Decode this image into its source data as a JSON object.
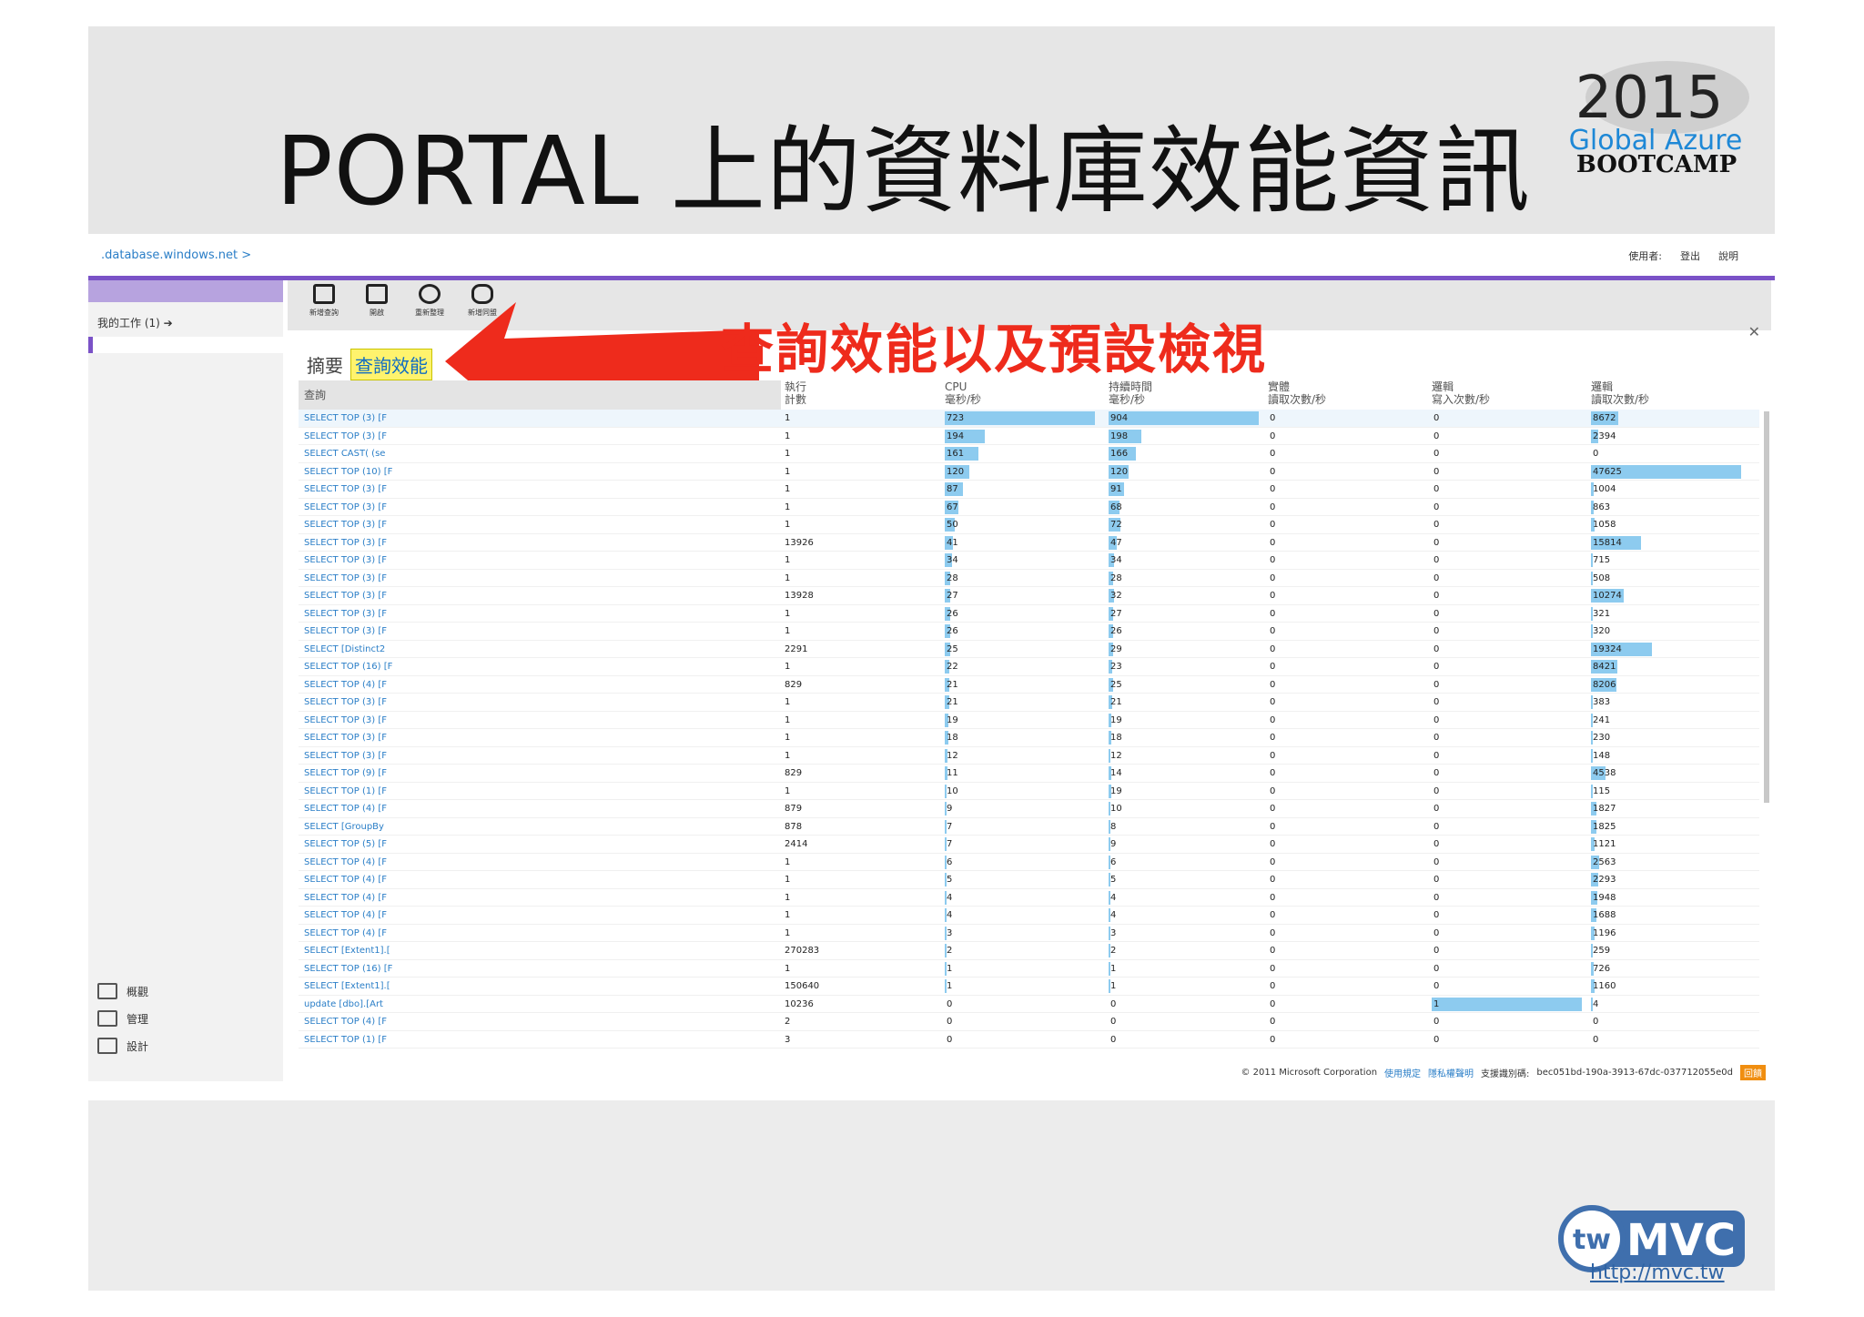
{
  "slide": {
    "title": "PORTAL 上的資料庫效能資訊",
    "annotation": "查詢效能以及預設檢視",
    "logo_year": "2015",
    "logo_line1": "Global Azure",
    "logo_line2": "BOOTCAMP",
    "mvc_logo": "MVC",
    "mvc_url": "http://mvc.tw"
  },
  "portal": {
    "breadcrumb": ".database.windows.net >",
    "user_label": "使用者:",
    "logout": "登出",
    "help": "說明",
    "my_work": "我的工作 (1)",
    "nav": [
      {
        "label": "概觀",
        "icon": "overview-icon"
      },
      {
        "label": "管理",
        "icon": "manage-icon"
      },
      {
        "label": "設計",
        "icon": "design-icon"
      }
    ],
    "toolbar": [
      {
        "label": "新增查詢",
        "icon": "new-query-icon"
      },
      {
        "label": "開啟",
        "icon": "open-folder-icon"
      },
      {
        "label": "重新整理",
        "icon": "refresh-icon"
      },
      {
        "label": "新增同盟",
        "icon": "add-federation-icon"
      }
    ],
    "tabs": {
      "summary": "摘要",
      "query_perf": "查詢效能"
    },
    "columns": {
      "query": "查詢",
      "exec_1": "執行",
      "exec_2": "計數",
      "cpu_1": "CPU",
      "cpu_2": "毫秒/秒",
      "dur_1": "持續時間",
      "dur_2": "毫秒/秒",
      "phys_1": "實體",
      "phys_2": "讀取次數/秒",
      "lw_1": "邏輯",
      "lw_2": "寫入次數/秒",
      "lr_1": "邏輯",
      "lr_2": "讀取次數/秒"
    },
    "rows": [
      {
        "q": "SELECT TOP (3) [F",
        "e": "1",
        "cpu": "723",
        "dur": "904",
        "phys": "0",
        "lw": "0",
        "lr": "8672"
      },
      {
        "q": "SELECT TOP (3) [F",
        "e": "1",
        "cpu": "194",
        "dur": "198",
        "phys": "0",
        "lw": "0",
        "lr": "2394"
      },
      {
        "q": "SELECT CAST( (se",
        "e": "1",
        "cpu": "161",
        "dur": "166",
        "phys": "0",
        "lw": "0",
        "lr": "0"
      },
      {
        "q": "SELECT TOP (10) [F",
        "e": "1",
        "cpu": "120",
        "dur": "120",
        "phys": "0",
        "lw": "0",
        "lr": "47625"
      },
      {
        "q": "SELECT TOP (3) [F",
        "e": "1",
        "cpu": "87",
        "dur": "91",
        "phys": "0",
        "lw": "0",
        "lr": "1004"
      },
      {
        "q": "SELECT TOP (3) [F",
        "e": "1",
        "cpu": "67",
        "dur": "68",
        "phys": "0",
        "lw": "0",
        "lr": "863"
      },
      {
        "q": "SELECT TOP (3) [F",
        "e": "1",
        "cpu": "50",
        "dur": "72",
        "phys": "0",
        "lw": "0",
        "lr": "1058"
      },
      {
        "q": "SELECT TOP (3) [F",
        "e": "13926",
        "cpu": "41",
        "dur": "47",
        "phys": "0",
        "lw": "0",
        "lr": "15814"
      },
      {
        "q": "SELECT TOP (3) [F",
        "e": "1",
        "cpu": "34",
        "dur": "34",
        "phys": "0",
        "lw": "0",
        "lr": "715"
      },
      {
        "q": "SELECT TOP (3) [F",
        "e": "1",
        "cpu": "28",
        "dur": "28",
        "phys": "0",
        "lw": "0",
        "lr": "508"
      },
      {
        "q": "SELECT TOP (3) [F",
        "e": "13928",
        "cpu": "27",
        "dur": "32",
        "phys": "0",
        "lw": "0",
        "lr": "10274"
      },
      {
        "q": "SELECT TOP (3) [F",
        "e": "1",
        "cpu": "26",
        "dur": "27",
        "phys": "0",
        "lw": "0",
        "lr": "321"
      },
      {
        "q": "SELECT TOP (3) [F",
        "e": "1",
        "cpu": "26",
        "dur": "26",
        "phys": "0",
        "lw": "0",
        "lr": "320"
      },
      {
        "q": "SELECT [Distinct2",
        "e": "2291",
        "cpu": "25",
        "dur": "29",
        "phys": "0",
        "lw": "0",
        "lr": "19324"
      },
      {
        "q": "SELECT TOP (16) [F",
        "e": "1",
        "cpu": "22",
        "dur": "23",
        "phys": "0",
        "lw": "0",
        "lr": "8421"
      },
      {
        "q": "SELECT TOP (4) [F",
        "e": "829",
        "cpu": "21",
        "dur": "25",
        "phys": "0",
        "lw": "0",
        "lr": "8206"
      },
      {
        "q": "SELECT TOP (3) [F",
        "e": "1",
        "cpu": "21",
        "dur": "21",
        "phys": "0",
        "lw": "0",
        "lr": "383"
      },
      {
        "q": "SELECT TOP (3) [F",
        "e": "1",
        "cpu": "19",
        "dur": "19",
        "phys": "0",
        "lw": "0",
        "lr": "241"
      },
      {
        "q": "SELECT TOP (3) [F",
        "e": "1",
        "cpu": "18",
        "dur": "18",
        "phys": "0",
        "lw": "0",
        "lr": "230"
      },
      {
        "q": "SELECT TOP (3) [F",
        "e": "1",
        "cpu": "12",
        "dur": "12",
        "phys": "0",
        "lw": "0",
        "lr": "148"
      },
      {
        "q": "SELECT TOP (9) [F",
        "e": "829",
        "cpu": "11",
        "dur": "14",
        "phys": "0",
        "lw": "0",
        "lr": "4538"
      },
      {
        "q": "SELECT TOP (1) [F",
        "e": "1",
        "cpu": "10",
        "dur": "19",
        "phys": "0",
        "lw": "0",
        "lr": "115"
      },
      {
        "q": "SELECT TOP (4) [F",
        "e": "879",
        "cpu": "9",
        "dur": "10",
        "phys": "0",
        "lw": "0",
        "lr": "1827"
      },
      {
        "q": "SELECT [GroupBy",
        "e": "878",
        "cpu": "7",
        "dur": "8",
        "phys": "0",
        "lw": "0",
        "lr": "1825"
      },
      {
        "q": "SELECT TOP (5) [F",
        "e": "2414",
        "cpu": "7",
        "dur": "9",
        "phys": "0",
        "lw": "0",
        "lr": "1121"
      },
      {
        "q": "SELECT TOP (4) [F",
        "e": "1",
        "cpu": "6",
        "dur": "6",
        "phys": "0",
        "lw": "0",
        "lr": "2563"
      },
      {
        "q": "SELECT TOP (4) [F",
        "e": "1",
        "cpu": "5",
        "dur": "5",
        "phys": "0",
        "lw": "0",
        "lr": "2293"
      },
      {
        "q": "SELECT TOP (4) [F",
        "e": "1",
        "cpu": "4",
        "dur": "4",
        "phys": "0",
        "lw": "0",
        "lr": "1948"
      },
      {
        "q": "SELECT TOP (4) [F",
        "e": "1",
        "cpu": "4",
        "dur": "4",
        "phys": "0",
        "lw": "0",
        "lr": "1688"
      },
      {
        "q": "SELECT TOP (4) [F",
        "e": "1",
        "cpu": "3",
        "dur": "3",
        "phys": "0",
        "lw": "0",
        "lr": "1196"
      },
      {
        "q": "SELECT [Extent1].[",
        "e": "270283",
        "cpu": "2",
        "dur": "2",
        "phys": "0",
        "lw": "0",
        "lr": "259"
      },
      {
        "q": "SELECT TOP (16) [F",
        "e": "1",
        "cpu": "1",
        "dur": "1",
        "phys": "0",
        "lw": "0",
        "lr": "726"
      },
      {
        "q": "SELECT [Extent1].[",
        "e": "150640",
        "cpu": "1",
        "dur": "1",
        "phys": "0",
        "lw": "0",
        "lr": "1160"
      },
      {
        "q": "update [dbo].[Art",
        "e": "10236",
        "cpu": "0",
        "dur": "0",
        "phys": "0",
        "lw": "1",
        "lr": "4"
      },
      {
        "q": "SELECT TOP (4) [F",
        "e": "2",
        "cpu": "0",
        "dur": "0",
        "phys": "0",
        "lw": "0",
        "lr": "0"
      },
      {
        "q": "SELECT TOP (1) [F",
        "e": "3",
        "cpu": "0",
        "dur": "0",
        "phys": "0",
        "lw": "0",
        "lr": "0"
      }
    ],
    "footer": {
      "copyright": "© 2011 Microsoft Corporation",
      "terms": "使用規定",
      "privacy": "隱私權聲明",
      "support_label": "支援識別碼:",
      "support_id": "bec051bd-190a-3913-67dc-037712055e0d",
      "feedback": "回饋"
    }
  },
  "colors": {
    "accent": "#7a52c7",
    "link": "#2a7ec7",
    "bar": "#8dcbef",
    "annotation": "#ee2b1c",
    "highlight": "#fff36d"
  }
}
